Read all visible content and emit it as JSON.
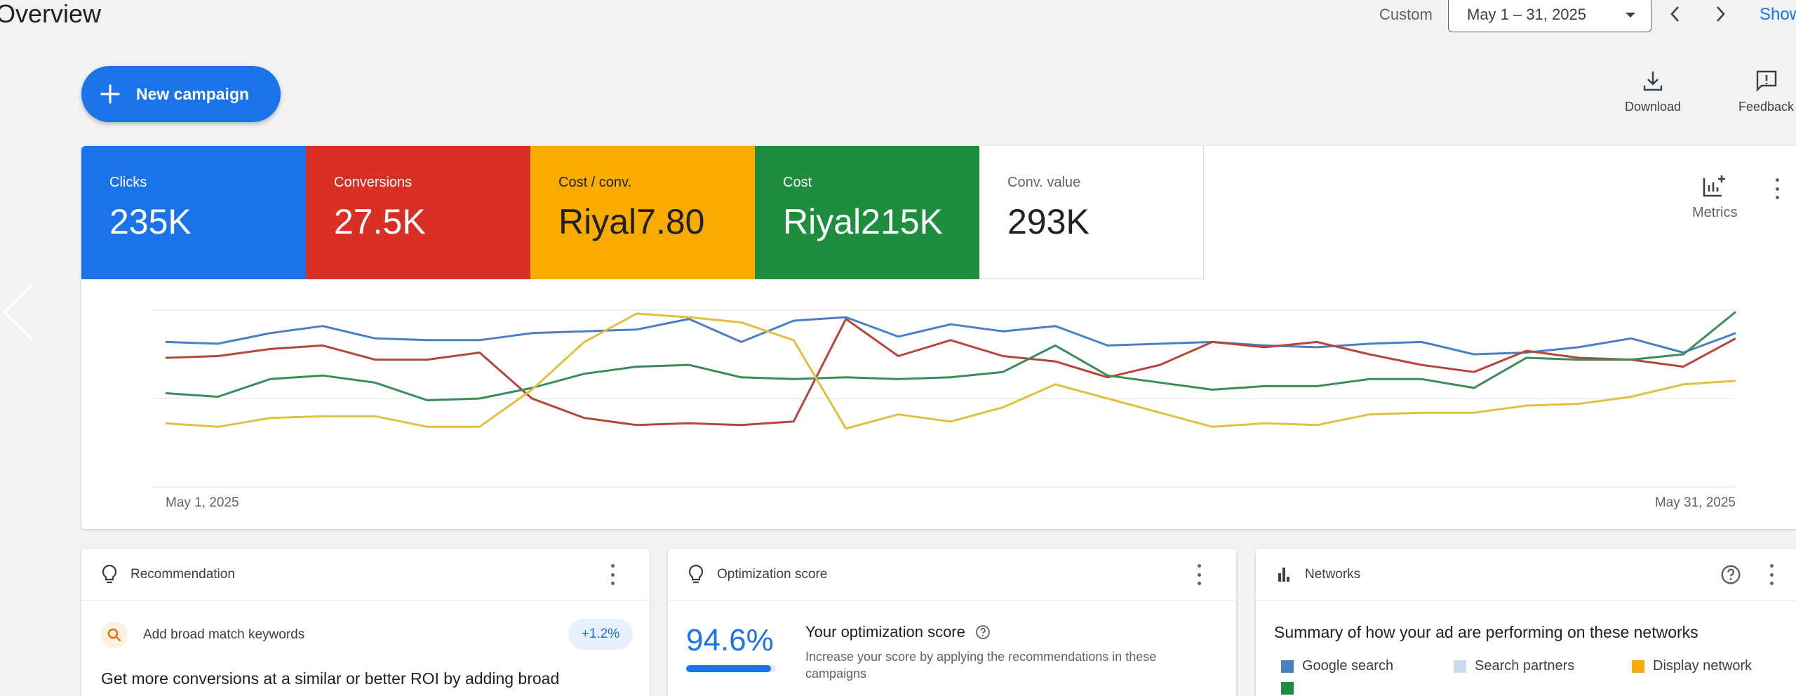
{
  "header": {
    "title": "Overview",
    "date_label": "Custom",
    "date_range": "May 1 – 31, 2025",
    "show_link": "Show"
  },
  "actions": {
    "new_campaign": "New campaign",
    "download": "Download",
    "feedback": "Feedback"
  },
  "metrics": [
    {
      "label": "Clicks",
      "value": "235K",
      "color": "#1a73e8"
    },
    {
      "label": "Conversions",
      "value": "27.5K",
      "color": "#d93025"
    },
    {
      "label": "Cost / conv.",
      "value": "Riyal7.80",
      "color": "#f9ab00"
    },
    {
      "label": "Cost",
      "value": "Riyal215K",
      "color": "#1e8e3e"
    },
    {
      "label": "Conv. value",
      "value": "293K",
      "color": "#ffffff"
    }
  ],
  "metrics_tool_label": "Metrics",
  "chart_data": {
    "type": "line",
    "x_labels": [
      "May 1, 2025",
      "May 31, 2025"
    ],
    "x": [
      1,
      2,
      3,
      4,
      5,
      6,
      7,
      8,
      9,
      10,
      11,
      12,
      13,
      14,
      15,
      16,
      17,
      18,
      19,
      20,
      21,
      22,
      23,
      24,
      25,
      26,
      27,
      28,
      29,
      30,
      31
    ],
    "ylim": [
      0,
      100
    ],
    "grid": true,
    "series": [
      {
        "color": "#4a7fc1",
        "values": [
          82,
          81,
          87,
          91,
          84,
          83,
          83,
          87,
          88,
          89,
          95,
          82,
          94,
          96,
          85,
          92,
          88,
          91,
          80,
          81,
          82,
          80,
          79,
          81,
          82,
          75,
          76,
          79,
          84,
          76,
          87
        ]
      },
      {
        "color": "#b5473a",
        "values": [
          73,
          74,
          78,
          80,
          72,
          72,
          76,
          50,
          39,
          35,
          36,
          35,
          37,
          95,
          74,
          83,
          74,
          71,
          62,
          69,
          82,
          79,
          82,
          75,
          69,
          65,
          77,
          73,
          72,
          68,
          84
        ]
      },
      {
        "color": "#3c8c5a",
        "values": [
          53,
          51,
          61,
          63,
          59,
          49,
          50,
          56,
          64,
          68,
          69,
          62,
          61,
          62,
          61,
          62,
          65,
          80,
          63,
          59,
          55,
          57,
          57,
          61,
          61,
          56,
          73,
          72,
          72,
          75,
          99
        ]
      },
      {
        "color": "#e0c040",
        "values": [
          36,
          34,
          39,
          40,
          40,
          34,
          34,
          55,
          82,
          98,
          96,
          93,
          83,
          33,
          41,
          37,
          45,
          58,
          50,
          42,
          34,
          36,
          35,
          41,
          42,
          42,
          46,
          47,
          51,
          58,
          60
        ]
      }
    ]
  },
  "recommendation": {
    "title": "Recommendation",
    "item": "Add broad match keywords",
    "badge": "+1.2%",
    "description": "Get more conversions at a similar or better ROI by adding broad"
  },
  "optimization": {
    "title": "Optimization score",
    "score": "94.6%",
    "score_fraction": 0.946,
    "heading": "Your optimization score",
    "subtext": "Increase your score by applying the recommendations in these campaigns"
  },
  "networks": {
    "title": "Networks",
    "summary": "Summary of how your ad are performing on these networks",
    "legend": [
      {
        "label": "Google search",
        "color": "#4a7fc1"
      },
      {
        "label": "Search partners",
        "color": "#c8dcf0"
      },
      {
        "label": "Display network",
        "color": "#f9ab00"
      }
    ]
  }
}
